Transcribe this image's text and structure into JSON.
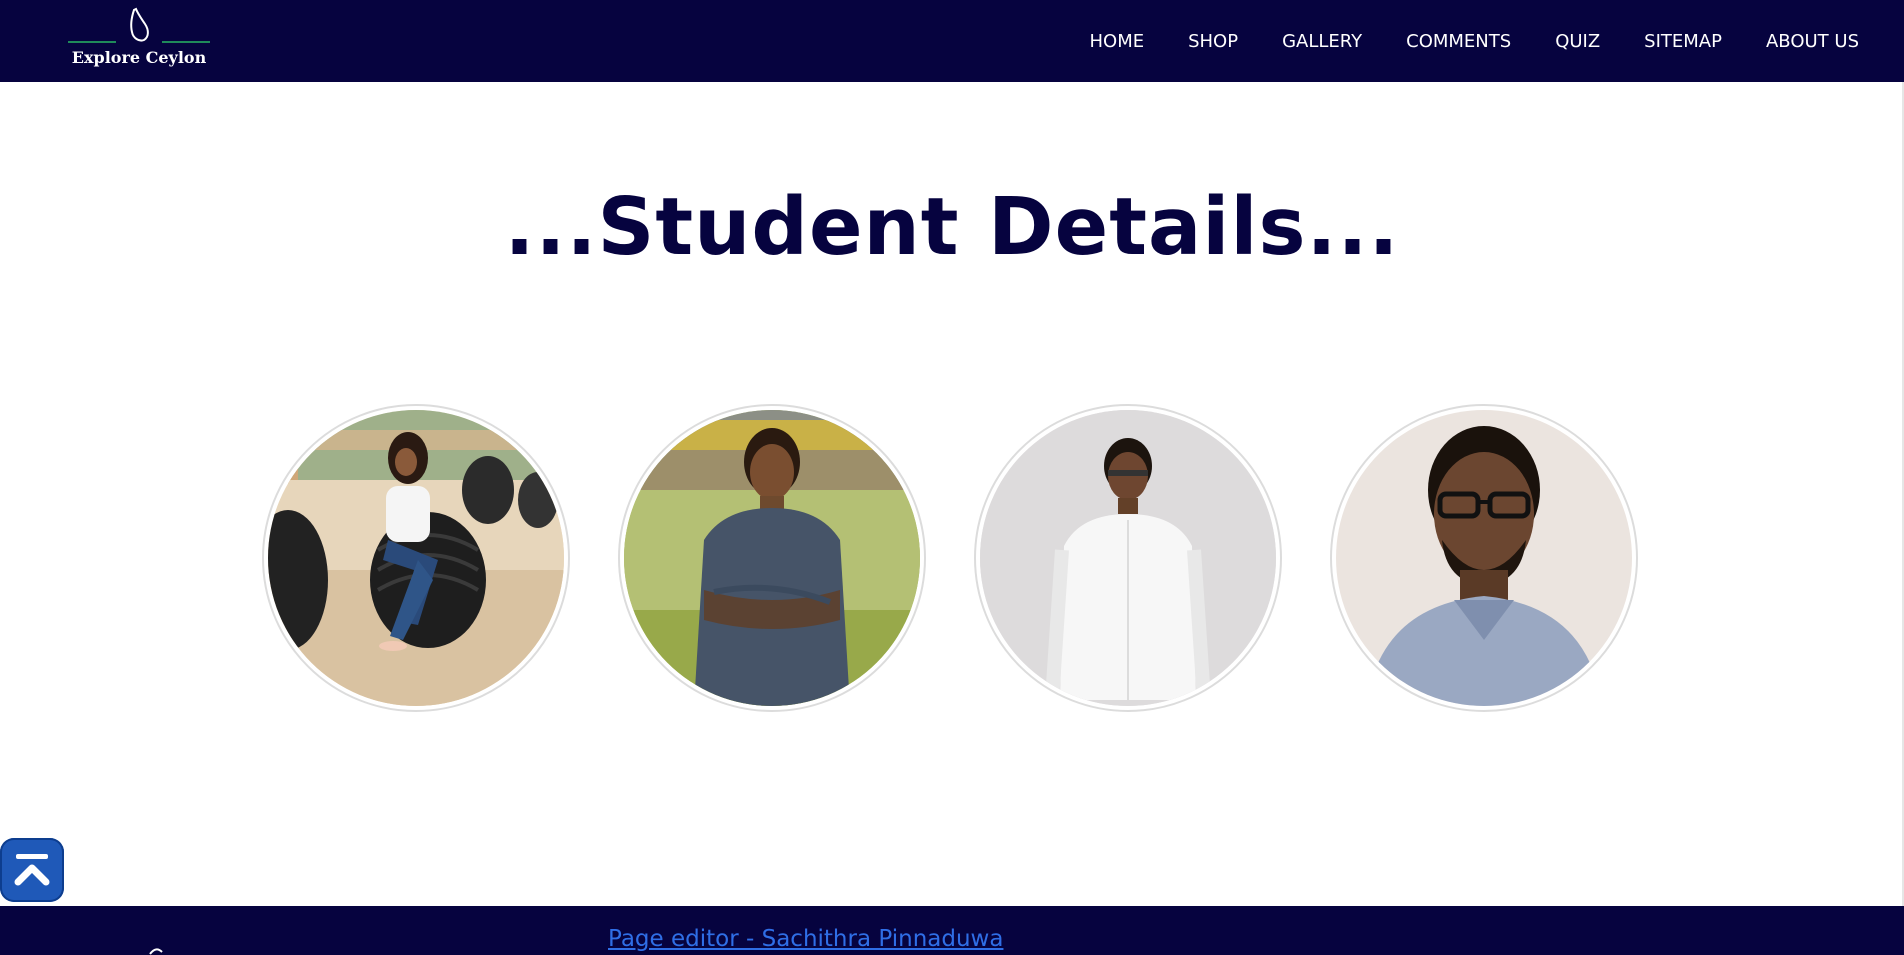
{
  "header": {
    "logo_text": "Explore Ceylon",
    "nav": [
      {
        "label": "HOME"
      },
      {
        "label": "SHOP"
      },
      {
        "label": "GALLERY"
      },
      {
        "label": "COMMENTS"
      },
      {
        "label": "QUIZ"
      },
      {
        "label": "SITEMAP"
      },
      {
        "label": "ABOUT US"
      }
    ]
  },
  "main": {
    "title": "...Student Details..."
  },
  "footer": {
    "editor_link": "Page editor - Sachithra Pinnaduwa"
  },
  "colors": {
    "navy": "#06033f",
    "link_blue": "#2f6ee6",
    "button_blue": "#1f59b8"
  },
  "icons": {
    "logo": "sri-lanka-map-icon",
    "back_to_top": "double-chevron-up-icon"
  }
}
